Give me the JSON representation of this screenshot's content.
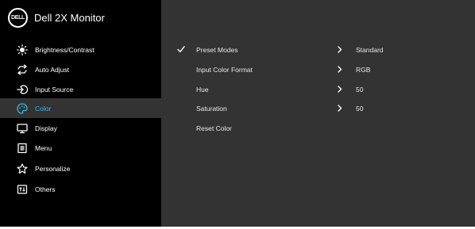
{
  "header": {
    "logo_text": "DELL",
    "title": "Dell 2X Monitor"
  },
  "sidebar": {
    "items": [
      {
        "label": "Brightness/Contrast",
        "icon": "brightness-icon",
        "active": false
      },
      {
        "label": "Auto Adjust",
        "icon": "auto-adjust-icon",
        "active": false
      },
      {
        "label": "Input Source",
        "icon": "input-source-icon",
        "active": false
      },
      {
        "label": "Color",
        "icon": "color-palette-icon",
        "active": true
      },
      {
        "label": "Display",
        "icon": "display-icon",
        "active": false
      },
      {
        "label": "Menu",
        "icon": "menu-icon",
        "active": false
      },
      {
        "label": "Personalize",
        "icon": "star-icon",
        "active": false
      },
      {
        "label": "Others",
        "icon": "others-icon",
        "active": false
      }
    ]
  },
  "main": {
    "rows": [
      {
        "label": "Preset Modes",
        "value": "Standard",
        "checked": true,
        "has_arrow": true
      },
      {
        "label": "Input Color Format",
        "value": "RGB",
        "checked": false,
        "has_arrow": true
      },
      {
        "label": "Hue",
        "value": "50",
        "checked": false,
        "has_arrow": true
      },
      {
        "label": "Saturation",
        "value": "50",
        "checked": false,
        "has_arrow": true
      },
      {
        "label": "Reset Color",
        "value": "",
        "checked": false,
        "has_arrow": false
      }
    ]
  },
  "colors": {
    "panel_bg": "#333333",
    "sidebar_bg": "#000000",
    "active_text": "#3db5e6",
    "text": "#ffffff"
  }
}
